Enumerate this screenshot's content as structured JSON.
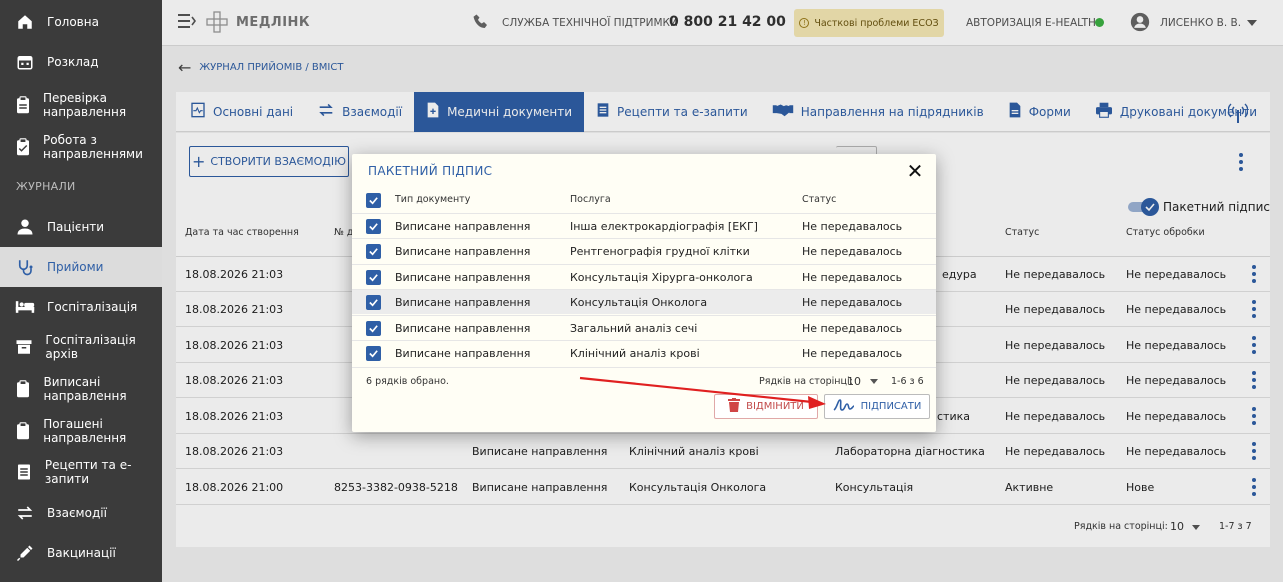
{
  "sidebar": {
    "items": [
      {
        "label": "Головна",
        "icon": "home-icon"
      },
      {
        "label": "Розклад",
        "icon": "calendar-icon"
      },
      {
        "label": "Перевірка направлення",
        "icon": "clipboard-icon"
      },
      {
        "label": "Робота з направленнями",
        "icon": "clipboard-check-icon"
      },
      {
        "label": "Пацієнти",
        "icon": "person-icon"
      },
      {
        "label": "Прийоми",
        "icon": "stethoscope-icon"
      },
      {
        "label": "Госпіталізація",
        "icon": "bed-icon"
      },
      {
        "label": "Госпіталізація архів",
        "icon": "archive-icon"
      },
      {
        "label": "Виписані направлення",
        "icon": "clipboard-icon"
      },
      {
        "label": "Погашені направлення",
        "icon": "clipboard-icon"
      },
      {
        "label": "Рецепти та е-запити",
        "icon": "list-icon"
      },
      {
        "label": "Взаємодії",
        "icon": "swap-icon"
      },
      {
        "label": "Вакцинації",
        "icon": "syringe-icon"
      }
    ],
    "section_label": "ЖУРНАЛИ"
  },
  "topbar": {
    "logo": "МЕДЛІНК",
    "support_label": "СЛУЖБА ТЕХНІЧНОЇ ПІДТРИМКИ",
    "support_phone": "0 800 21 42 00",
    "warning": "Часткові проблеми ЕСОЗ",
    "auth": "АВТОРИЗАЦІЯ E-HEALTH",
    "user": "ЛИСЕНКО В. В."
  },
  "breadcrumb": "ЖУРНАЛ ПРИЙОМІВ / ВМІСТ",
  "tabs": [
    {
      "label": "Основні дані"
    },
    {
      "label": "Взаємодії"
    },
    {
      "label": "Медичні документи"
    },
    {
      "label": "Рецепти та е-запити"
    },
    {
      "label": "Направлення на підрядників"
    },
    {
      "label": "Форми"
    },
    {
      "label": "Друковані документи"
    }
  ],
  "toolbar": {
    "create_label": "СТВОРИТИ ВЗАЄМОДІЮ",
    "batch_label": "Пакетний підпис"
  },
  "table": {
    "headers": {
      "date": "Дата та час створення",
      "num": "№ до",
      "status": "Статус",
      "proc": "Статус обробки"
    },
    "rows": [
      {
        "date": "18.08.2026 21:03",
        "num": "",
        "type": "",
        "service": "",
        "category": "едура",
        "status": "Не передавалось",
        "proc": "Не передавалось"
      },
      {
        "date": "18.08.2026 21:03",
        "num": "",
        "type": "",
        "service": "",
        "category": "",
        "status": "Не передавалось",
        "proc": "Не передавалось"
      },
      {
        "date": "18.08.2026 21:03",
        "num": "",
        "type": "",
        "service": "",
        "category": "",
        "status": "Не передавалось",
        "proc": "Не передавалось"
      },
      {
        "date": "18.08.2026 21:03",
        "num": "",
        "type": "",
        "service": "",
        "category": "",
        "status": "Не передавалось",
        "proc": "Не передавалось"
      },
      {
        "date": "18.08.2026 21:03",
        "num": "",
        "type": "",
        "service": "",
        "category": "стика",
        "status": "Не передавалось",
        "proc": "Не передавалось"
      },
      {
        "date": "18.08.2026 21:03",
        "num": "",
        "type": "Виписане направлення",
        "service": "Клінічний аналіз крові",
        "category": "Лабораторна діагностика",
        "status": "Не передавалось",
        "proc": "Не передавалось"
      },
      {
        "date": "18.08.2026 21:00",
        "num": "8253-3382-0938-5218",
        "type": "Виписане направлення",
        "service": "Консультація Онколога",
        "category": "Консультація",
        "status": "Активне",
        "proc": "Нове"
      }
    ],
    "pager_label": "Рядків на сторінці:",
    "pager_size": "10",
    "pager_range": "1-7 з 7"
  },
  "modal": {
    "title": "ПАКЕТНИЙ ПІДПИС",
    "headers": {
      "type": "Тип документу",
      "service": "Послуга",
      "status": "Статус"
    },
    "rows": [
      {
        "type": "Виписане направлення",
        "service": "Інша електрокардіографія [ЕКГ]",
        "status": "Не передавалось"
      },
      {
        "type": "Виписане направлення",
        "service": "Рентгенографія грудної клітки",
        "status": "Не передавалось"
      },
      {
        "type": "Виписане направлення",
        "service": "Консультація Хірурга-онколога",
        "status": "Не передавалось"
      },
      {
        "type": "Виписане направлення",
        "service": "Консультація Онколога",
        "status": "Не передавалось"
      },
      {
        "type": "Виписане направлення",
        "service": "Загальний аналіз сечі",
        "status": "Не передавалось"
      },
      {
        "type": "Виписане направлення",
        "service": "Клінічний аналіз крові",
        "status": "Не передавалось"
      }
    ],
    "selected_text": "6 рядків обрано.",
    "pager_label": "Рядків на сторінці:",
    "pager_size": "10",
    "pager_range": "1-6 з 6",
    "cancel_label": "ВІДМІНИТИ",
    "sign_label": "ПІДПИСАТИ"
  },
  "colors": {
    "accent": "#2f5fa6",
    "sidebar": "#3b3b3b",
    "warning_bg": "#f6e9b5",
    "online": "#3cb043",
    "annotation_arrow": "#e02020"
  }
}
